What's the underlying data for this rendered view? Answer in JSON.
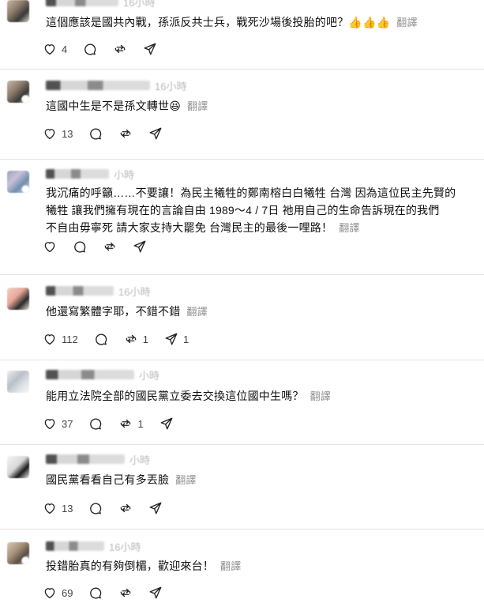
{
  "translate_label": "翻譯",
  "posts": [
    {
      "time": "16小時",
      "text": "這個應該是國共內戰，孫派反共士兵，戰死沙場後投胎的吧？👍👍👍",
      "likes": "4",
      "reposts": "",
      "shares": ""
    },
    {
      "time": "16小時",
      "text": "這國中生是不是孫文轉世😆",
      "likes": "13",
      "reposts": "",
      "shares": ""
    },
    {
      "time": "小時",
      "text_lines": [
        "我沉痛的呼籲……不要讓！為民主犧牲的鄭南榕白白犧牲 台灣 因為這位民主先賢的",
        "犧牲 讓我們擁有現在的言論自由 1989～4 / 7日 祂用自己的生命告訴現在的我們",
        "不自由毋寧死 請大家支持大罷免 台灣民主的最後一哩路！"
      ],
      "likes": "",
      "reposts": "",
      "shares": ""
    },
    {
      "time": "16小時",
      "text": "他還寫繁體字耶，不錯不錯",
      "likes": "112",
      "reposts": "1",
      "shares": "1"
    },
    {
      "time": "小時",
      "text": "能用立法院全部的國民黨立委去交換這位國中生嗎？",
      "likes": "37",
      "reposts": "1",
      "shares": ""
    },
    {
      "time": "小時",
      "text": "國民黨看看自己有多丟臉",
      "likes": "13",
      "reposts": "",
      "shares": ""
    },
    {
      "time": "16小時",
      "text": "投錯胎真的有夠倒楣，歡迎來台！",
      "likes": "69",
      "reposts": "",
      "shares": ""
    }
  ]
}
